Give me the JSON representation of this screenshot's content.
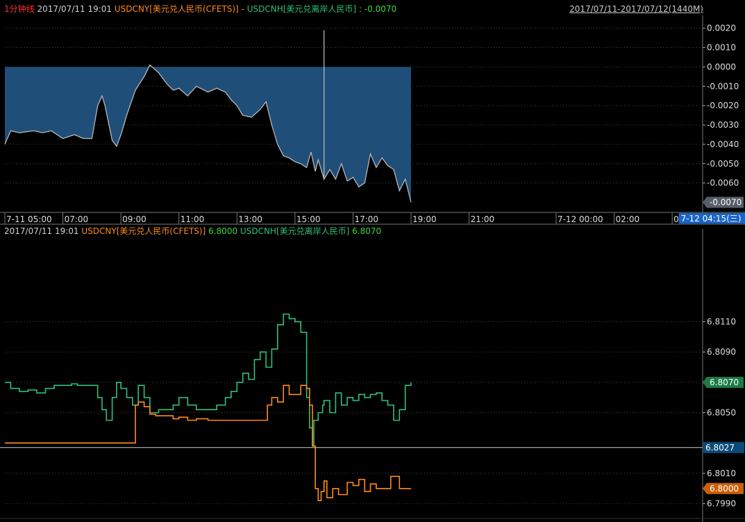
{
  "header_top": {
    "tool": "1分钟线",
    "datetime": "2017/07/11 19:01",
    "series1": "USDCNY[美元兑人民币(CFETS)]",
    "separator": "-",
    "series2": "USDCNH[美元兑离岸人民币]",
    "value": ": -0.0070",
    "range": "2017/07/11-2017/07/12(1440M)"
  },
  "header_bottom": {
    "datetime": "2017/07/11 19:01",
    "series1": "USDCNY[美元兑人民币(CFETS)]",
    "series1_value": "6.8000",
    "series2": "USDCNH[美元兑离岸人民币]",
    "series2_value": "6.8070"
  },
  "time_axis": {
    "labels": [
      "7-11 05:00",
      "07:00",
      "09:00",
      "11:00",
      "13:00",
      "15:00",
      "17:00",
      "19:00",
      "21:00",
      "7-12 00:00",
      "02:00",
      "0"
    ],
    "positions_hours": [
      5,
      7,
      9,
      11,
      13,
      15,
      17,
      19,
      21,
      24,
      26,
      28
    ],
    "cursor_label": "7-12 04:15(三)",
    "cursor_hours": 28.25,
    "x_range_hours": [
      5,
      29.05
    ]
  },
  "colors": {
    "background": "#000000",
    "spread_fill": "#1f4e79",
    "spread_line": "#b8b8b8",
    "usdcny": "#ff8c1a",
    "usdcnh": "#2ec27a",
    "grid": "#444444",
    "tag_spread": "#555d66",
    "tag_usdcnh": "#1e7a46",
    "tag_usdcny": "#c8600a",
    "tag_cross": "#0b4a78",
    "cursor_tag": "#1a64c8"
  },
  "chart_data": [
    {
      "type": "area",
      "y_ticks": [
        "0.0020",
        "0.0010",
        "0.0000",
        "-0.0010",
        "-0.0020",
        "-0.0030",
        "-0.0040",
        "-0.0050",
        "-0.0060"
      ],
      "y_tick_values": [
        0.002,
        0.001,
        0.0,
        -0.001,
        -0.002,
        -0.003,
        -0.004,
        -0.005,
        -0.006
      ],
      "ylim": [
        -0.00752,
        0.00267
      ],
      "last_value_label": "-0.0070",
      "last_value": -0.007,
      "baseline": 0.0,
      "series": [
        {
          "name": "USDCNY[美元兑人民币(CFETS)] - USDCNH[美元兑离岸人民币]",
          "x": [
            5.0,
            5.2,
            5.5,
            6.0,
            6.3,
            6.6,
            7.0,
            7.4,
            7.7,
            8.0,
            8.2,
            8.35,
            8.45,
            8.7,
            8.85,
            9.0,
            9.2,
            9.5,
            9.8,
            10.0,
            10.3,
            10.6,
            10.8,
            11.0,
            11.3,
            11.6,
            12.0,
            12.3,
            12.6,
            12.8,
            13.0,
            13.2,
            13.5,
            13.8,
            14.0,
            14.2,
            14.4,
            14.6,
            14.8,
            15.0,
            15.2,
            15.4,
            15.55,
            15.7,
            15.8,
            16.0,
            16.2,
            16.4,
            16.6,
            16.8,
            17.0,
            17.2,
            17.4,
            17.6,
            17.8,
            18.0,
            18.2,
            18.4,
            18.6,
            18.8,
            19.0
          ],
          "y": [
            -0.004,
            -0.0033,
            -0.0034,
            -0.0033,
            -0.0034,
            -0.0033,
            -0.0037,
            -0.0035,
            -0.0037,
            -0.0037,
            -0.002,
            -0.0015,
            -0.002,
            -0.0038,
            -0.0041,
            -0.0035,
            -0.0025,
            -0.0012,
            -0.0005,
            0.0001,
            -0.0003,
            -0.0009,
            -0.0012,
            -0.0011,
            -0.0015,
            -0.001,
            -0.0013,
            -0.0011,
            -0.0013,
            -0.0017,
            -0.002,
            -0.0025,
            -0.0026,
            -0.0022,
            -0.0018,
            -0.003,
            -0.004,
            -0.0046,
            -0.0047,
            -0.0049,
            -0.005,
            -0.0052,
            -0.0044,
            -0.0054,
            -0.0048,
            -0.0058,
            -0.0053,
            -0.0058,
            -0.005,
            -0.0059,
            -0.0057,
            -0.0062,
            -0.006,
            -0.0045,
            -0.0052,
            -0.0047,
            -0.0051,
            -0.0053,
            -0.0064,
            -0.0058,
            -0.007
          ]
        }
      ],
      "spikes": [
        {
          "x": 16.0,
          "y": 0.0019
        }
      ]
    },
    {
      "type": "line",
      "y_ticks": [
        "6.8110",
        "6.8090",
        "6.8070",
        "6.8050",
        "6.8010",
        "6.7990"
      ],
      "y_tick_values": [
        6.811,
        6.809,
        6.807,
        6.805,
        6.801,
        6.799
      ],
      "ylim": [
        6.79825,
        6.81665
      ],
      "crosshair_label": "6.8027",
      "crosshair_value": 6.8027,
      "series": [
        {
          "name": "USDCNH[美元兑离岸人民币]",
          "value_label": "6.8070",
          "value": 6.807,
          "x": [
            5.0,
            5.2,
            5.5,
            5.8,
            6.1,
            6.4,
            6.7,
            7.0,
            7.3,
            7.5,
            7.8,
            8.0,
            8.2,
            8.35,
            8.5,
            8.7,
            8.85,
            9.0,
            9.2,
            9.4,
            9.6,
            9.8,
            10.0,
            10.3,
            10.6,
            10.8,
            11.0,
            11.3,
            11.6,
            12.0,
            12.3,
            12.6,
            12.8,
            13.0,
            13.2,
            13.4,
            13.6,
            13.8,
            14.0,
            14.2,
            14.4,
            14.6,
            14.8,
            15.0,
            15.2,
            15.4,
            15.5,
            15.6,
            15.65,
            15.8,
            15.95,
            16.0,
            16.2,
            16.4,
            16.6,
            16.8,
            17.0,
            17.2,
            17.4,
            17.6,
            17.8,
            18.0,
            18.2,
            18.4,
            18.6,
            18.8,
            19.0
          ],
          "y": [
            6.807,
            6.8066,
            6.8064,
            6.8065,
            6.8063,
            6.8066,
            6.8068,
            6.8068,
            6.8069,
            6.8068,
            6.8068,
            6.8068,
            6.806,
            6.8052,
            6.8045,
            6.806,
            6.807,
            6.8066,
            6.806,
            6.8055,
            6.8068,
            6.806,
            6.805,
            6.8052,
            6.8052,
            6.8055,
            6.806,
            6.8055,
            6.8052,
            6.8052,
            6.8055,
            6.806,
            6.8064,
            6.807,
            6.8076,
            6.8072,
            6.8085,
            6.809,
            6.808,
            6.8092,
            6.8108,
            6.8115,
            6.8112,
            6.811,
            6.8103,
            6.806,
            6.804,
            6.8028,
            6.8045,
            6.805,
            6.8055,
            6.8058,
            6.805,
            6.8063,
            6.8055,
            6.806,
            6.8058,
            6.8062,
            6.806,
            6.8062,
            6.8063,
            6.8058,
            6.8055,
            6.8045,
            6.8052,
            6.8068,
            6.807
          ]
        },
        {
          "name": "USDCNY[美元兑人民币(CFETS)]",
          "value_label": "6.8000",
          "value": 6.8,
          "x": [
            5.0,
            6.0,
            7.0,
            8.0,
            8.5,
            9.0,
            9.45,
            9.5,
            9.6,
            9.8,
            10.0,
            10.2,
            10.5,
            10.8,
            11.0,
            11.3,
            11.6,
            12.0,
            12.3,
            12.6,
            12.8,
            13.0,
            13.5,
            14.0,
            14.05,
            14.2,
            14.4,
            14.6,
            14.8,
            15.0,
            15.2,
            15.4,
            15.5,
            15.6,
            15.7,
            15.8,
            15.9,
            16.0,
            16.1,
            16.3,
            16.5,
            16.8,
            17.0,
            17.2,
            17.4,
            17.6,
            17.8,
            18.0,
            18.3,
            18.6,
            19.0
          ],
          "y": [
            6.803,
            6.803,
            6.803,
            6.803,
            6.803,
            6.803,
            6.803,
            6.8055,
            6.8057,
            6.8054,
            6.8049,
            6.8048,
            6.8048,
            6.8046,
            6.8047,
            6.8045,
            6.8046,
            6.8045,
            6.8045,
            6.8045,
            6.8045,
            6.8045,
            6.8045,
            6.8045,
            6.8055,
            6.806,
            6.8057,
            6.8068,
            6.8062,
            6.8062,
            6.8068,
            6.8066,
            6.8055,
            6.8028,
            6.8,
            6.7992,
            6.7998,
            6.8005,
            6.7994,
            6.8,
            6.7996,
            6.8004,
            6.8002,
            6.8006,
            6.7998,
            6.8003,
            6.8,
            6.8,
            6.8008,
            6.8,
            6.8
          ]
        }
      ]
    }
  ]
}
